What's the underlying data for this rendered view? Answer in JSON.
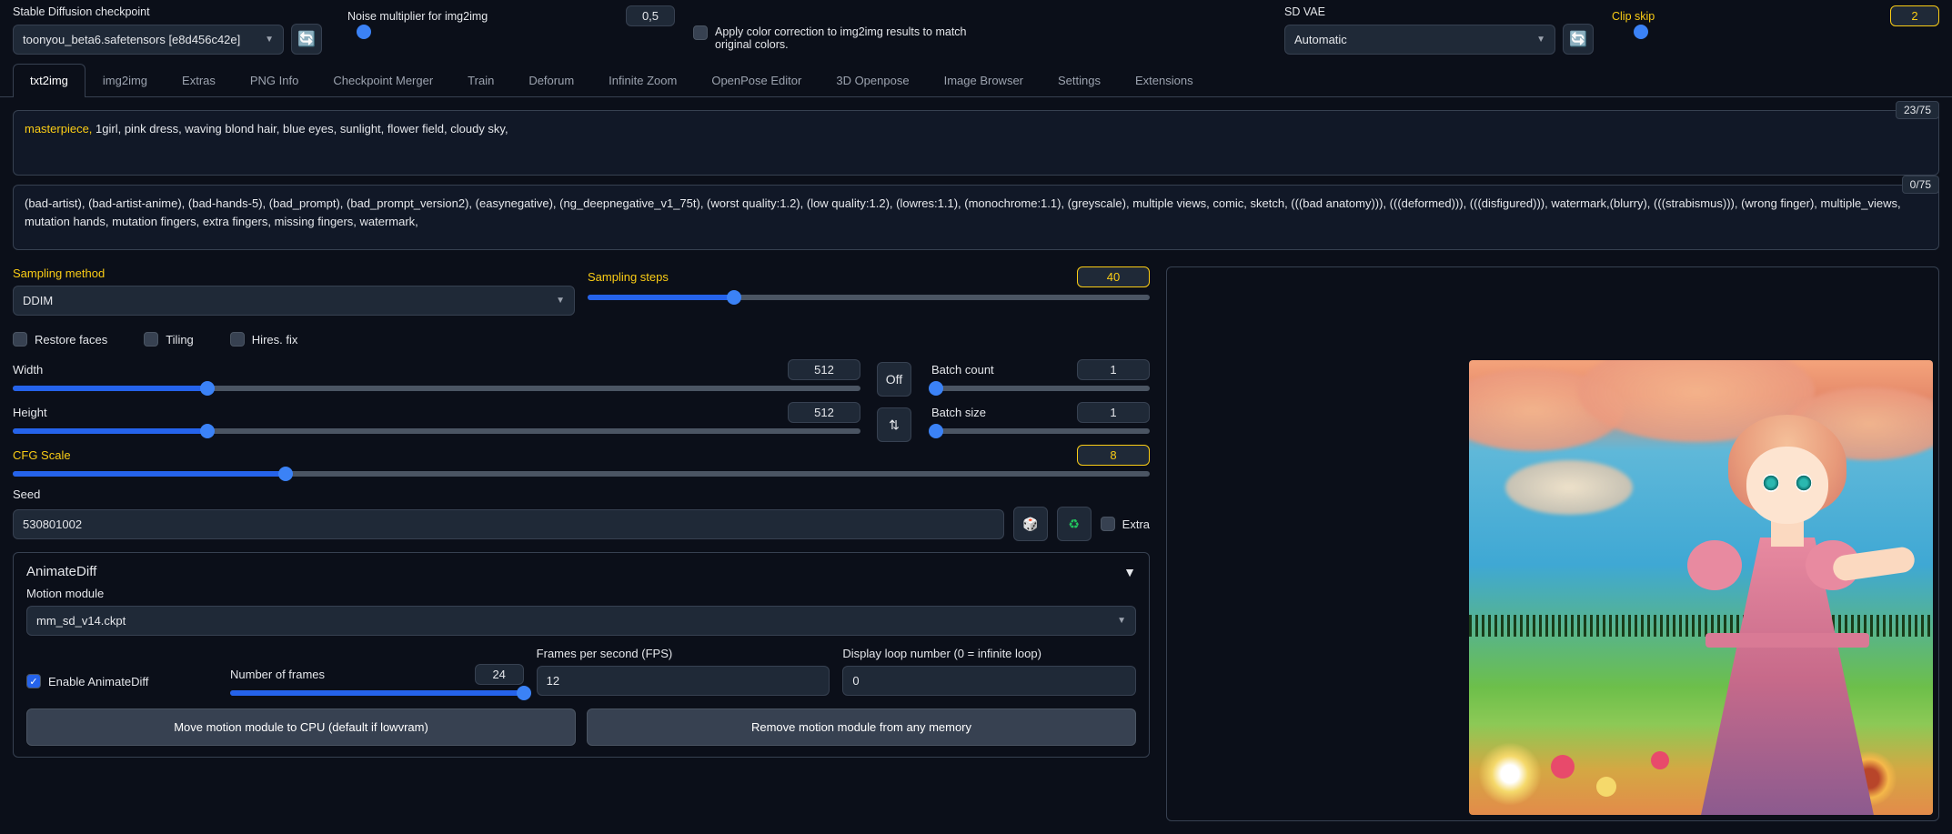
{
  "top": {
    "checkpoint_label": "Stable Diffusion checkpoint",
    "checkpoint_value": "toonyou_beta6.safetensors [e8d456c42e]",
    "noise_label": "Noise multiplier for img2img",
    "noise_value": "0,5",
    "color_correct_label": "Apply color correction to img2img results to match original colors.",
    "sdvae_label": "SD VAE",
    "sdvae_value": "Automatic",
    "clip_label": "Clip skip",
    "clip_value": "2"
  },
  "tabs": [
    "txt2img",
    "img2img",
    "Extras",
    "PNG Info",
    "Checkpoint Merger",
    "Train",
    "Deforum",
    "Infinite Zoom",
    "OpenPose Editor",
    "3D Openpose",
    "Image Browser",
    "Settings",
    "Extensions"
  ],
  "prompt": {
    "counter": "23/75",
    "hl": "masterpiece,",
    "rest": " 1girl, pink dress, waving blond hair, blue eyes, sunlight, flower field, cloudy sky,"
  },
  "neg": {
    "counter": "0/75",
    "text": "(bad-artist), (bad-artist-anime), (bad-hands-5), (bad_prompt), (bad_prompt_version2), (easynegative), (ng_deepnegative_v1_75t), (worst quality:1.2), (low quality:1.2), (lowres:1.1), (monochrome:1.1), (greyscale), multiple views, comic, sketch, (((bad anatomy))), (((deformed))), (((disfigured))), watermark,(blurry), (((strabismus))), (wrong finger), multiple_views, mutation hands, mutation fingers, extra fingers, missing fingers, watermark,"
  },
  "sampling": {
    "method_label": "Sampling method",
    "method_value": "DDIM",
    "steps_label": "Sampling steps",
    "steps_value": "40"
  },
  "checks": {
    "restore": "Restore faces",
    "tiling": "Tiling",
    "hires": "Hires. fix"
  },
  "dims": {
    "width_label": "Width",
    "width_value": "512",
    "height_label": "Height",
    "height_value": "512",
    "off": "Off",
    "swap": "⇅"
  },
  "batch": {
    "count_label": "Batch count",
    "count_value": "1",
    "size_label": "Batch size",
    "size_value": "1"
  },
  "cfg": {
    "label": "CFG Scale",
    "value": "8"
  },
  "seed": {
    "label": "Seed",
    "value": "530801002",
    "dice": "🎲",
    "recycle": "♻",
    "extra": "Extra"
  },
  "ad": {
    "title": "AnimateDiff",
    "mm_label": "Motion module",
    "mm_value": "mm_sd_v14.ckpt",
    "enable": "Enable AnimateDiff",
    "frames_label": "Number of frames",
    "frames_value": "24",
    "fps_label": "Frames per second (FPS)",
    "fps_value": "12",
    "loop_label": "Display loop number (0 = infinite loop)",
    "loop_value": "0",
    "btn_cpu": "Move motion module to CPU (default if lowvram)",
    "btn_rm": "Remove motion module from any memory"
  }
}
